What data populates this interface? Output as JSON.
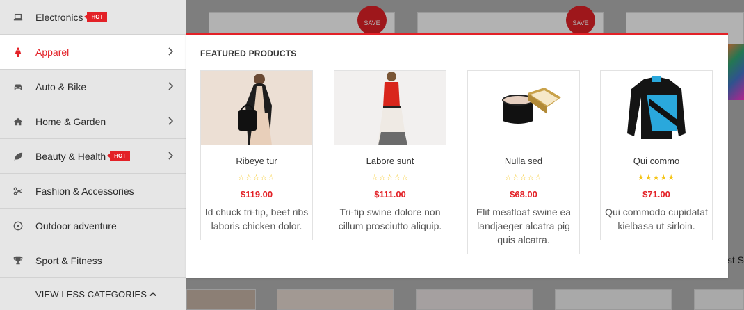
{
  "categories": [
    {
      "label": "Electronics",
      "icon": "laptop-icon",
      "hot": true,
      "badge": "HOT",
      "chevron": false
    },
    {
      "label": "Apparel",
      "icon": "person-icon",
      "hot": false,
      "chevron": true,
      "active": true
    },
    {
      "label": "Auto & Bike",
      "icon": "car-icon",
      "hot": false,
      "chevron": true
    },
    {
      "label": "Home & Garden",
      "icon": "home-icon",
      "hot": false,
      "chevron": true
    },
    {
      "label": "Beauty & Health",
      "icon": "leaf-icon",
      "hot": true,
      "badge": "HOT",
      "chevron": true
    },
    {
      "label": "Fashion & Accessories",
      "icon": "scissors-icon",
      "hot": false,
      "chevron": false
    },
    {
      "label": "Outdoor adventure",
      "icon": "compass-icon",
      "hot": false,
      "chevron": false
    },
    {
      "label": "Sport & Fitness",
      "icon": "trophy-icon",
      "hot": false,
      "chevron": false
    }
  ],
  "view_less": "VIEW LESS CATEGORIES",
  "mega_menu": {
    "title": "FEATURED PRODUCTS",
    "products": [
      {
        "name": "Ribeye tur",
        "price": "$119.00",
        "rating": 0,
        "description": "Id chuck tri-tip, beef ribs laboris chicken dolor.",
        "image": "woman-cardigan-handbag"
      },
      {
        "name": "Labore sunt",
        "price": "$111.00",
        "rating": 0,
        "description": "Tri-tip swine dolore non cillum prosciutto aliquip.",
        "image": "woman-red-dress"
      },
      {
        "name": "Nulla sed",
        "price": "$68.00",
        "rating": 0,
        "description": "Elit meatloaf swine ea landjaeger alcatra pig quis alcatra.",
        "image": "cosmetic-jars"
      },
      {
        "name": "Qui commo",
        "price": "$71.00",
        "rating": 5,
        "description": "Qui commodo cupidatat kielbasa ut sirloin.",
        "image": "cycling-jersey"
      }
    ]
  },
  "background": {
    "save_label": "SAVE",
    "partial_text": "st S"
  },
  "colors": {
    "accent": "#e32127",
    "star": "#f5c518"
  }
}
